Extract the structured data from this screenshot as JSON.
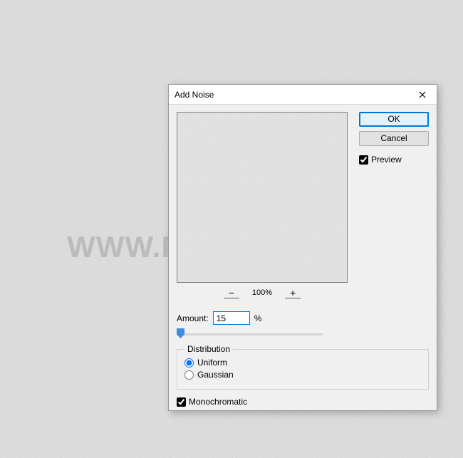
{
  "watermark": "WWW.PSD-DUDE.com",
  "dialog": {
    "title": "Add Noise",
    "ok_label": "OK",
    "cancel_label": "Cancel",
    "preview_label": "Preview",
    "preview_checked": true,
    "zoom": {
      "minus": "−",
      "plus": "+",
      "value": "100%"
    },
    "amount": {
      "label": "Amount:",
      "value": "15",
      "suffix": "%"
    },
    "distribution": {
      "legend": "Distribution",
      "uniform": "Uniform",
      "gaussian": "Gaussian",
      "selected": "uniform"
    },
    "monochromatic": {
      "label": "Monochromatic",
      "checked": true
    }
  }
}
